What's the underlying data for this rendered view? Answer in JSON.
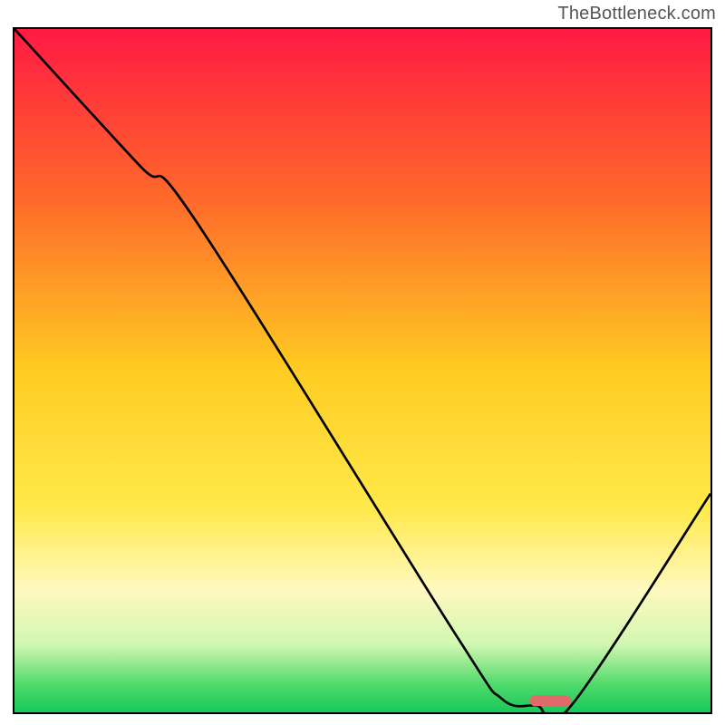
{
  "watermark": "TheBottleneck.com",
  "chart_data": {
    "type": "line",
    "title": "",
    "xlabel": "",
    "ylabel": "",
    "xlim": [
      0,
      100
    ],
    "ylim": [
      0,
      100
    ],
    "grid": false,
    "gradient_stops": [
      {
        "offset": 0,
        "color": "#ff1a44"
      },
      {
        "offset": 25,
        "color": "#ff6a2a"
      },
      {
        "offset": 50,
        "color": "#ffcc22"
      },
      {
        "offset": 70,
        "color": "#ffe94a"
      },
      {
        "offset": 82,
        "color": "#fff9bf"
      },
      {
        "offset": 90,
        "color": "#d2f7b2"
      },
      {
        "offset": 96,
        "color": "#4fd96b"
      },
      {
        "offset": 100,
        "color": "#17c85a"
      }
    ],
    "curve": [
      {
        "x": 0,
        "y": 100
      },
      {
        "x": 18,
        "y": 80
      },
      {
        "x": 26,
        "y": 72
      },
      {
        "x": 63,
        "y": 12
      },
      {
        "x": 70,
        "y": 2
      },
      {
        "x": 75,
        "y": 1
      },
      {
        "x": 80,
        "y": 1
      },
      {
        "x": 100,
        "y": 32
      }
    ],
    "marker": {
      "x": 77,
      "y": 1.7,
      "width": 6,
      "height": 1.6,
      "color": "#e06a6a"
    }
  }
}
